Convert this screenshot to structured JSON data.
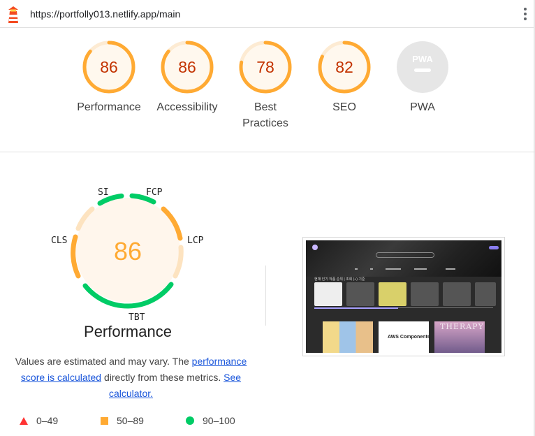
{
  "topbar": {
    "url": "https://portfolly013.netlify.app/main"
  },
  "categories": [
    {
      "label": "Performance",
      "score": 86,
      "color": "#fa3"
    },
    {
      "label": "Accessibility",
      "score": 86,
      "color": "#fa3"
    },
    {
      "label": "Best Practices",
      "score": 78,
      "color": "#fa3"
    },
    {
      "label": "SEO",
      "score": 82,
      "color": "#fa3"
    },
    {
      "label": "PWA",
      "score": null,
      "badge": "PWA"
    }
  ],
  "performance": {
    "score": "86",
    "title": "Performance",
    "metrics": {
      "si": "SI",
      "fcp": "FCP",
      "lcp": "LCP",
      "tbt": "TBT",
      "cls": "CLS"
    }
  },
  "note": {
    "prefix": "Values are estimated and may vary. The ",
    "link1": "performance score is calculated",
    "middle": " directly from these metrics.",
    "link2": "See calculator."
  },
  "legend": {
    "fail": "0–49",
    "average": "50–89",
    "pass": "90–100"
  },
  "colors": {
    "fail": "#ff3333",
    "average": "#ffaa33",
    "pass": "#00cc66",
    "gaugeBg": "#fff8ee",
    "scoreText": "#c33300"
  },
  "screenshot": {
    "section_label": "현재 인기 작품 순위 | 조회 (+) 기준",
    "tile2_title": "AWS Components",
    "tile3_title": "THERAPY"
  }
}
